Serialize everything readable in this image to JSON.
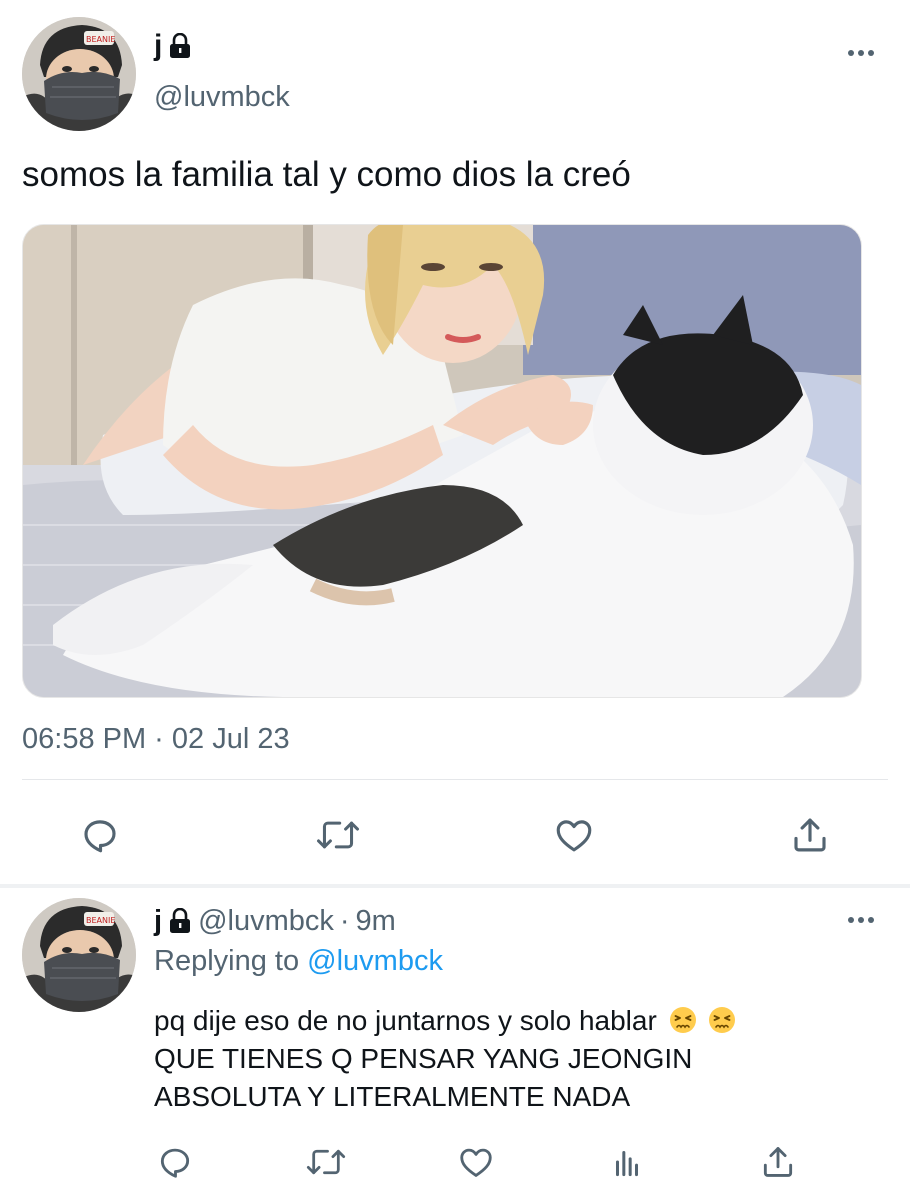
{
  "tweet": {
    "display_name": "j",
    "handle": "@luvmbck",
    "text": "somos la familia tal y como dios la creó",
    "timestamp": "06:58 PM · 02 Jul 23",
    "avatar_icon": "avatar-masked-person",
    "media_icon": "photo-person-with-dog"
  },
  "actions": {
    "main": [
      "reply-icon",
      "retweet-icon",
      "like-icon",
      "share-icon"
    ],
    "reply": [
      "reply-icon",
      "retweet-icon",
      "like-icon",
      "analytics-icon",
      "share-icon"
    ]
  },
  "reply": {
    "display_name": "j",
    "handle": "@luvmbck",
    "separator": "·",
    "time": "9m",
    "replying_to_label": "Replying to",
    "replying_to_handle": "@luvmbck",
    "line1": "pq dije eso de no juntarnos y solo hablar",
    "emoji": [
      "😣",
      "😣"
    ],
    "line2": "QUE TIENES Q PENSAR YANG JEONGIN",
    "line3": "ABSOLUTA Y LITERALMENTE NADA"
  },
  "colors": {
    "text": "#0f1419",
    "secondary": "#536471",
    "link": "#1d9bf0",
    "divider": "#e5e7ea"
  }
}
